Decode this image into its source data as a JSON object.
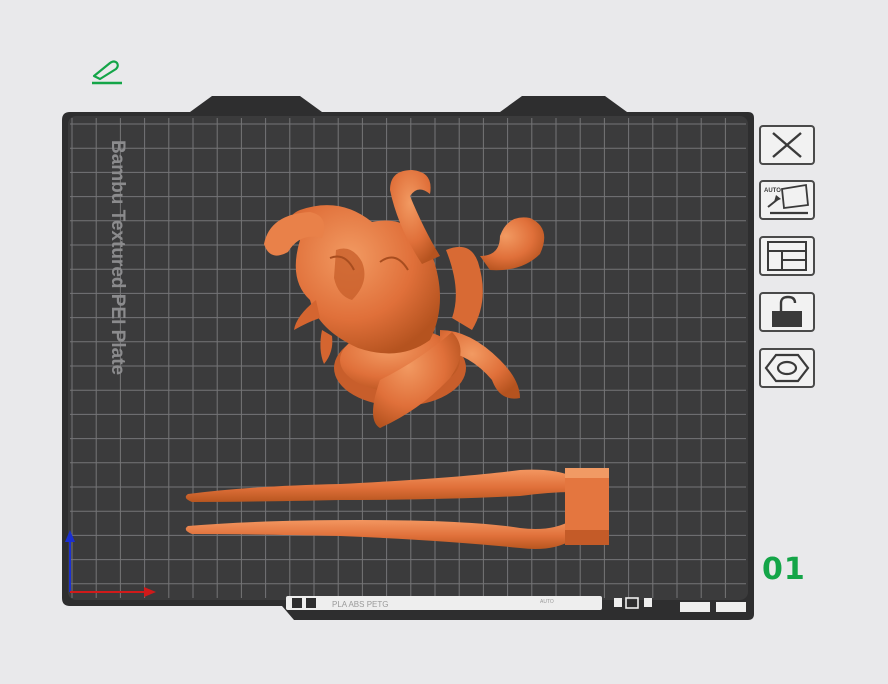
{
  "plate": {
    "label": "Bambu Textured PEI Plate",
    "number": "01",
    "filament_text": "PLA ABS PETG",
    "bed_type_text": "AUTO",
    "grid": "on"
  },
  "toolbar": {
    "items": [
      {
        "name": "close-plate-button",
        "icon": "x-icon"
      },
      {
        "name": "auto-orient-button",
        "icon": "auto-orient-icon",
        "text": "AUTO"
      },
      {
        "name": "arrange-button",
        "icon": "arrange-layout-icon"
      },
      {
        "name": "lock-plate-button",
        "icon": "lock-icon"
      },
      {
        "name": "plate-settings-button",
        "icon": "hexagon-nut-icon"
      }
    ]
  },
  "edit": {
    "icon": "pencil-edit-icon"
  },
  "colors": {
    "plate": "#3a3a3b",
    "grid": "#7a7a7c",
    "frame": "#2f2f30",
    "model": "#e0703a",
    "accent_green": "#14a548",
    "axis_x": "#d11a1a",
    "axis_y": "#1a2fd1"
  }
}
